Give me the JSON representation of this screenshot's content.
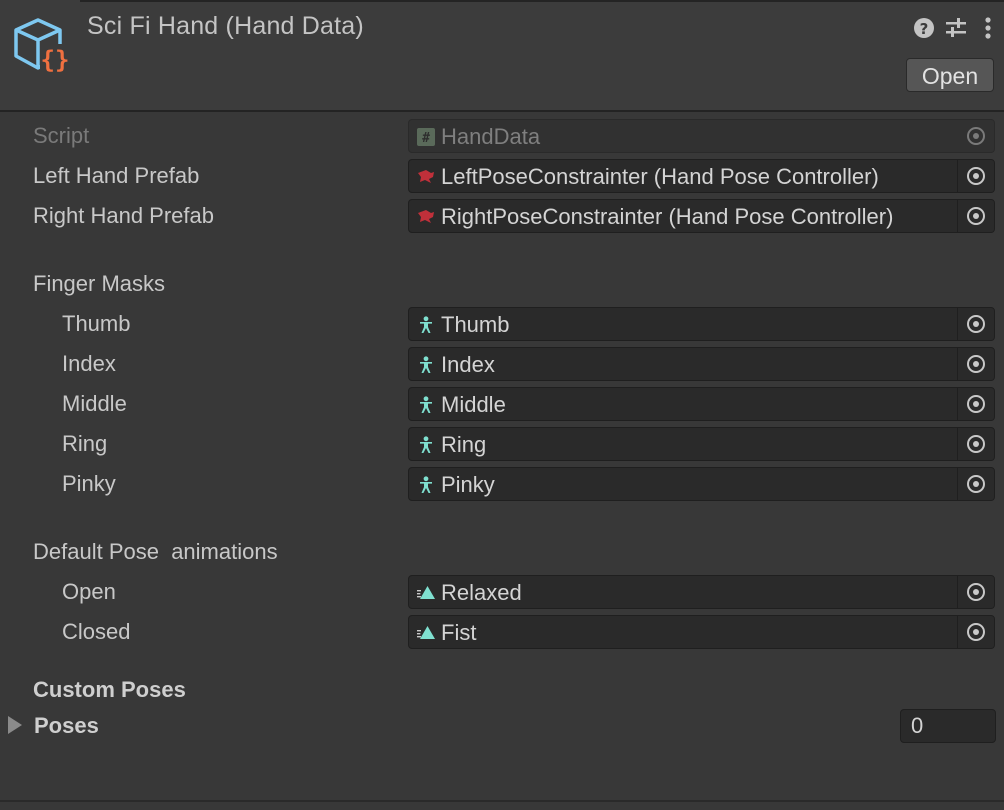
{
  "header": {
    "title": "Sci Fi Hand (Hand Data)",
    "open_label": "Open",
    "icons": [
      "help-icon",
      "settings-sliders-icon",
      "more-vertical-icon"
    ]
  },
  "fields": {
    "script": {
      "label": "Script",
      "value": "HandData"
    },
    "left_hand_prefab": {
      "label": "Left Hand Prefab",
      "value": "LeftPoseConstrainter (Hand Pose Controller)"
    },
    "right_hand_prefab": {
      "label": "Right Hand Prefab",
      "value": "RightPoseConstrainter (Hand Pose Controller)"
    }
  },
  "finger_masks": {
    "heading": "Finger Masks",
    "items": [
      {
        "label": "Thumb",
        "value": "Thumb"
      },
      {
        "label": "Index",
        "value": "Index"
      },
      {
        "label": "Middle",
        "value": "Middle"
      },
      {
        "label": "Ring",
        "value": "Ring"
      },
      {
        "label": "Pinky",
        "value": "Pinky"
      }
    ]
  },
  "default_pose": {
    "heading": "Default Pose  animations",
    "items": [
      {
        "label": "Open",
        "value": "Relaxed"
      },
      {
        "label": "Closed",
        "value": "Fist"
      }
    ]
  },
  "custom_poses": {
    "heading": "Custom Poses",
    "poses_label": "Poses",
    "poses_count": "0"
  },
  "colors": {
    "background": "#383838",
    "field_bg": "#2a2a2a",
    "avatar_mask_icon": "#7fe0d0",
    "prefab_icon": "#c0303a",
    "asset_icon_blue": "#7ec8f0",
    "asset_icon_orange": "#f07040"
  }
}
